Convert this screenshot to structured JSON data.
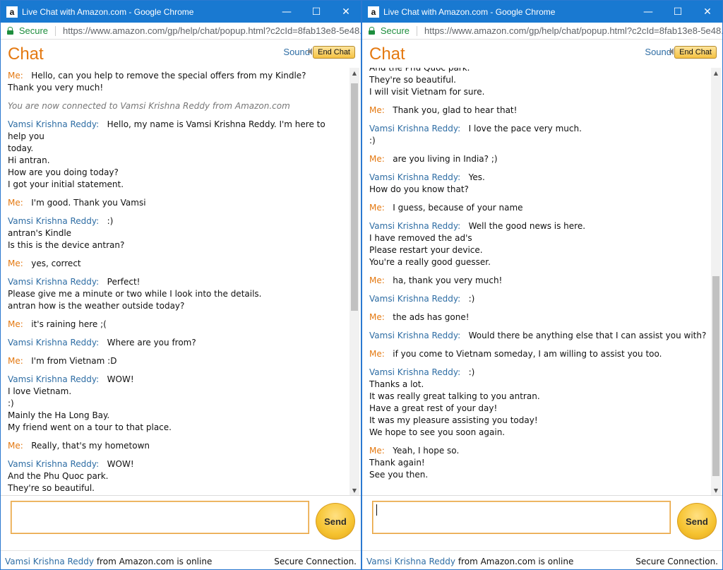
{
  "windows": [
    {
      "title": "Live Chat with Amazon.com - Google Chrome",
      "secure": "Secure",
      "url": "https://www.amazon.com/gp/help/chat/popup.html?c2cId=8fab13e8-5e48...",
      "chat_title": "Chat",
      "sound": "Sound",
      "end_chat": "End Chat",
      "send": "Send",
      "status_agent": "Vamsi Krishna Reddy",
      "status_text": " from Amazon.com is online",
      "status_secure": "Secure Connection.",
      "messages": [
        {
          "sender": "Me:",
          "type": "me",
          "lines": [
            "Hello, can you help to remove the special offers from my Kindle?",
            "Thank you very much!"
          ]
        },
        {
          "sender": "",
          "type": "system",
          "lines": [
            "You are now connected to Vamsi Krishna Reddy from Amazon.com"
          ]
        },
        {
          "sender": "Vamsi Krishna Reddy:",
          "type": "agent",
          "lines": [
            "Hello, my name is Vamsi Krishna Reddy. I'm here to help you",
            "today.",
            "Hi antran.",
            "How are you doing today?",
            "I got your initial statement."
          ]
        },
        {
          "sender": "Me:",
          "type": "me",
          "lines": [
            "I'm good. Thank you Vamsi"
          ]
        },
        {
          "sender": "Vamsi Krishna Reddy:",
          "type": "agent",
          "lines": [
            ":)",
            "antran's Kindle",
            "Is this is the device antran?"
          ]
        },
        {
          "sender": "Me:",
          "type": "me",
          "lines": [
            "yes, correct"
          ]
        },
        {
          "sender": "Vamsi Krishna Reddy:",
          "type": "agent",
          "lines": [
            "Perfect!",
            "Please give me a minute or two while I look into the details.",
            "antran how is the weather outside today?"
          ]
        },
        {
          "sender": "Me:",
          "type": "me",
          "lines": [
            "it's raining here ;("
          ]
        },
        {
          "sender": "Vamsi Krishna Reddy:",
          "type": "agent",
          "lines": [
            "Where are you from?"
          ]
        },
        {
          "sender": "Me:",
          "type": "me",
          "lines": [
            "I'm from Vietnam :D"
          ]
        },
        {
          "sender": "Vamsi Krishna Reddy:",
          "type": "agent",
          "lines": [
            "WOW!",
            "I love Vietnam.",
            ":)",
            "Mainly the Ha Long Bay.",
            "My friend went on a tour to that place."
          ]
        },
        {
          "sender": "Me:",
          "type": "me",
          "lines": [
            "Really, that's my hometown"
          ]
        },
        {
          "sender": "Vamsi Krishna Reddy:",
          "type": "agent",
          "lines": [
            "WOW!",
            "And the Phu Quoc park.",
            "They're so beautiful.",
            "I will visit Vietnam for sure."
          ]
        }
      ]
    },
    {
      "title": "Live Chat with Amazon.com - Google Chrome",
      "secure": "Secure",
      "url": "https://www.amazon.com/gp/help/chat/popup.html?c2cId=8fab13e8-5e48...",
      "chat_title": "Chat",
      "sound": "Sound",
      "end_chat": "End Chat",
      "send": "Send",
      "status_agent": "Vamsi Krishna Reddy",
      "status_text": " from Amazon.com is online",
      "status_secure": "Secure Connection.",
      "messages": [
        {
          "sender": "",
          "type": "cont",
          "lines": [
            "And the Phu Quoc park.",
            "They're so beautiful.",
            "I will visit Vietnam for sure."
          ]
        },
        {
          "sender": "Me:",
          "type": "me",
          "lines": [
            "Thank you, glad to hear that!"
          ]
        },
        {
          "sender": "Vamsi Krishna Reddy:",
          "type": "agent",
          "lines": [
            "I love the pace very much.",
            ":)"
          ]
        },
        {
          "sender": "Me:",
          "type": "me",
          "lines": [
            "are you living in India? ;)"
          ]
        },
        {
          "sender": "Vamsi Krishna Reddy:",
          "type": "agent",
          "lines": [
            "Yes.",
            "How do you know that?"
          ]
        },
        {
          "sender": "Me:",
          "type": "me",
          "lines": [
            "I guess, because of your name"
          ]
        },
        {
          "sender": "Vamsi Krishna Reddy:",
          "type": "agent",
          "lines": [
            "Well the good news is here.",
            "I have removed the ad's",
            "Please restart your device.",
            "You're a really good guesser."
          ]
        },
        {
          "sender": "Me:",
          "type": "me",
          "lines": [
            "ha, thank you very much!"
          ]
        },
        {
          "sender": "Vamsi Krishna Reddy:",
          "type": "agent",
          "lines": [
            ":)"
          ]
        },
        {
          "sender": "Me:",
          "type": "me",
          "lines": [
            "the ads has gone!"
          ]
        },
        {
          "sender": "Vamsi Krishna Reddy:",
          "type": "agent",
          "lines": [
            "Would there be anything else that I can assist you with?"
          ]
        },
        {
          "sender": "Me:",
          "type": "me",
          "lines": [
            "if you come to Vietnam someday, I am willing to assist you too."
          ]
        },
        {
          "sender": "Vamsi Krishna Reddy:",
          "type": "agent",
          "lines": [
            ":)",
            "Thanks a lot.",
            "It was really great talking to you antran.",
            "Have a great rest of your day!",
            "It was my pleasure assisting you today!",
            "We hope to see you soon again."
          ]
        },
        {
          "sender": "Me:",
          "type": "me",
          "lines": [
            "Yeah, I hope so.",
            "Thank again!",
            "See you then."
          ]
        }
      ]
    }
  ]
}
